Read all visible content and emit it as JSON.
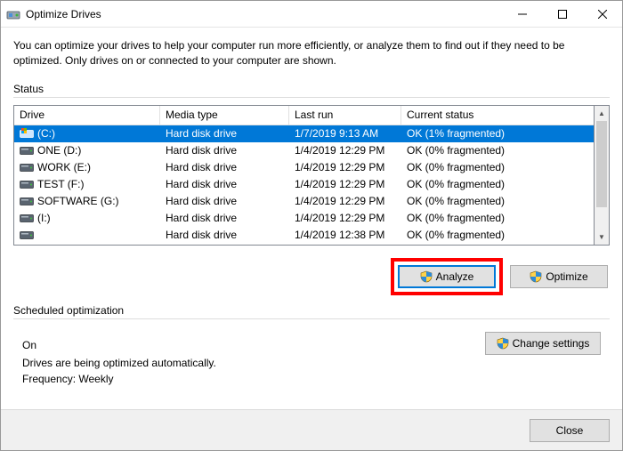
{
  "window": {
    "title": "Optimize Drives"
  },
  "description": "You can optimize your drives to help your computer run more efficiently, or analyze them to find out if they need to be optimized. Only drives on or connected to your computer are shown.",
  "status_label": "Status",
  "columns": {
    "drive": "Drive",
    "media": "Media type",
    "last": "Last run",
    "status": "Current status"
  },
  "rows": [
    {
      "name": "(C:)",
      "media": "Hard disk drive",
      "last": "1/7/2019 9:13 AM",
      "status": "OK (1% fragmented)",
      "selected": true,
      "icon": "drive-windows"
    },
    {
      "name": "ONE (D:)",
      "media": "Hard disk drive",
      "last": "1/4/2019 12:29 PM",
      "status": "OK (0% fragmented)",
      "selected": false,
      "icon": "drive"
    },
    {
      "name": "WORK (E:)",
      "media": "Hard disk drive",
      "last": "1/4/2019 12:29 PM",
      "status": "OK (0% fragmented)",
      "selected": false,
      "icon": "drive"
    },
    {
      "name": "TEST (F:)",
      "media": "Hard disk drive",
      "last": "1/4/2019 12:29 PM",
      "status": "OK (0% fragmented)",
      "selected": false,
      "icon": "drive"
    },
    {
      "name": "SOFTWARE (G:)",
      "media": "Hard disk drive",
      "last": "1/4/2019 12:29 PM",
      "status": "OK (0% fragmented)",
      "selected": false,
      "icon": "drive"
    },
    {
      "name": "(I:)",
      "media": "Hard disk drive",
      "last": "1/4/2019 12:29 PM",
      "status": "OK (0% fragmented)",
      "selected": false,
      "icon": "drive"
    },
    {
      "name": "",
      "media": "Hard disk drive",
      "last": "1/4/2019 12:38 PM",
      "status": "OK (0% fragmented)",
      "selected": false,
      "icon": "drive"
    }
  ],
  "buttons": {
    "analyze": "Analyze",
    "optimize": "Optimize",
    "change_settings": "Change settings",
    "close": "Close"
  },
  "scheduled": {
    "label": "Scheduled optimization",
    "state": "On",
    "desc": "Drives are being optimized automatically.",
    "freq": "Frequency: Weekly"
  }
}
